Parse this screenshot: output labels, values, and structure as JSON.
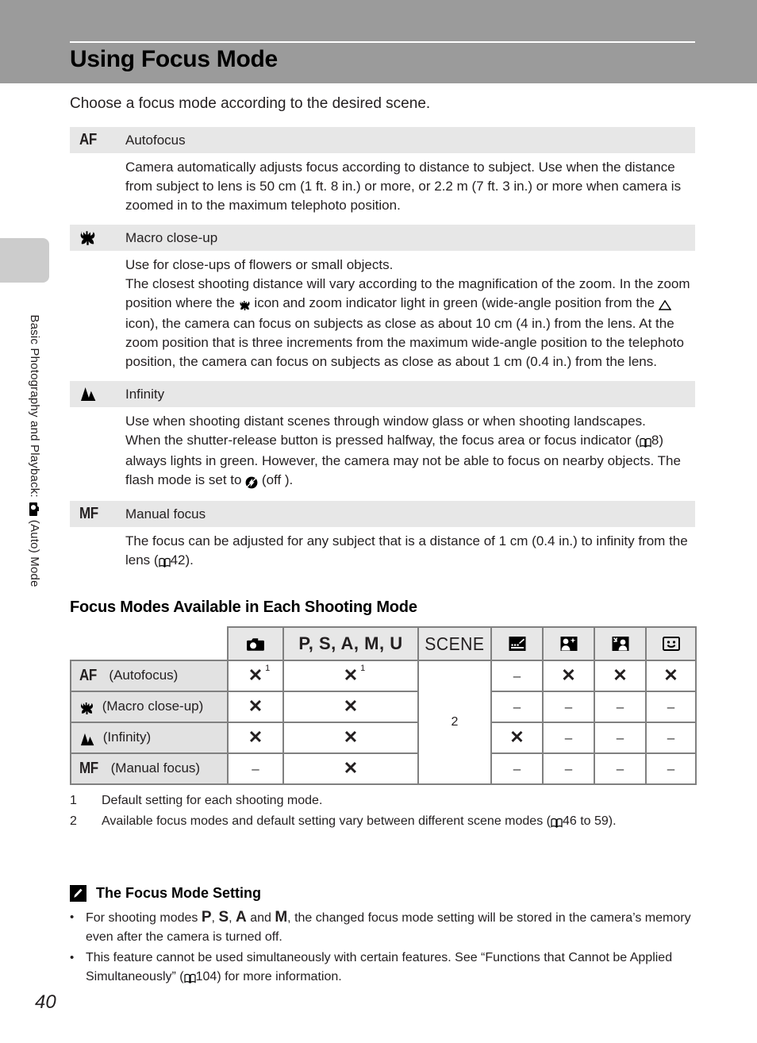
{
  "header": {
    "title": "Using Focus Mode"
  },
  "sidebar": {
    "chapter_label_part1": "Basic Photography and Playback:",
    "chapter_label_part2": "(Auto) Mode",
    "camera_icon": "camera-icon"
  },
  "intro": "Choose a focus mode according to the desired scene.",
  "modes": [
    {
      "icon": "af-icon",
      "icon_text": "AF",
      "name": "Autofocus",
      "body": "Camera automatically adjusts focus according to distance to subject. Use when the distance from subject to lens is 50 cm (1 ft. 8 in.) or more, or 2.2 m (7 ft. 3 in.) or more when camera is zoomed in to the maximum telephoto position."
    },
    {
      "icon": "macro-tulip-icon",
      "icon_text": "",
      "name": "Macro close-up",
      "body_part1": "Use for close-ups of flowers or small objects.",
      "body_part2": "The closest shooting distance will vary according to the magnification of the zoom. In the zoom position where the ",
      "body_part3": " icon and zoom indicator light in green (wide-angle position from the ",
      "body_part4": " icon), the camera can focus on subjects as close as about 10 cm (4 in.) from the lens. At the zoom position that is three increments from the maximum wide-angle position to the telephoto position, the camera can focus on subjects as close as about 1 cm (0.4 in.) from the lens."
    },
    {
      "icon": "infinity-mountain-icon",
      "icon_text": "",
      "name": "Infinity",
      "body_part1": "Use when shooting distant scenes through window glass or when shooting landscapes.",
      "body_part2": "When the shutter-release button is pressed halfway, the focus area or focus indicator (",
      "body_ref_page": "8",
      "body_part3": ") always lights in green. However, the camera may not be able to focus on nearby objects. The flash mode is set to ",
      "body_part4": " (off )."
    },
    {
      "icon": "mf-icon",
      "icon_text": "MF",
      "name": "Manual focus",
      "body_part1": "The focus can be adjusted for any subject that is a distance of 1 cm (0.4 in.) to infinity from the lens (",
      "body_ref_page": "42",
      "body_part2": ")."
    }
  ],
  "table_section": {
    "heading": "Focus Modes Available in Each Shooting Mode",
    "columns": [
      {
        "id": "mode-col",
        "label": ""
      },
      {
        "id": "auto-mode",
        "label": "",
        "icon": "camera-icon"
      },
      {
        "id": "psamu-modes",
        "label": "P, S, A, M, U"
      },
      {
        "id": "scene-mode",
        "label": "SCENE"
      },
      {
        "id": "night-landscape-mode",
        "label": "",
        "icon": "night-landscape-icon"
      },
      {
        "id": "night-portrait-mode",
        "label": "",
        "icon": "night-portrait-icon"
      },
      {
        "id": "backlight-mode",
        "label": "",
        "icon": "backlight-icon"
      },
      {
        "id": "smart-portrait-mode",
        "label": "",
        "icon": "smile-icon"
      }
    ],
    "rows": [
      {
        "icon": "af-icon",
        "icon_text": "AF",
        "label": "(Autofocus)",
        "cells": [
          "check1",
          "check1",
          "scene",
          "dash",
          "check",
          "check",
          "check"
        ]
      },
      {
        "icon": "macro-tulip-icon",
        "icon_text": "",
        "label": "(Macro close-up)",
        "cells": [
          "check",
          "check",
          "scene",
          "dash",
          "dash",
          "dash",
          "dash"
        ]
      },
      {
        "icon": "infinity-mountain-icon",
        "icon_text": "",
        "label": "(Infinity)",
        "cells": [
          "check",
          "check",
          "scene",
          "check",
          "dash",
          "dash",
          "dash"
        ]
      },
      {
        "icon": "mf-icon",
        "icon_text": "MF",
        "label": "(Manual focus)",
        "cells": [
          "dash",
          "check",
          "scene",
          "dash",
          "dash",
          "dash",
          "dash"
        ]
      }
    ],
    "scene_cell_value": "2",
    "check_superscript": "1"
  },
  "footnotes": [
    {
      "num": "1",
      "text": "Default setting for each shooting mode."
    },
    {
      "num": "2",
      "text_part1": "Available focus modes and default setting vary between different scene modes (",
      "ref_page": "46 to 59",
      "text_part2": ")."
    }
  ],
  "note": {
    "icon": "pencil-note-icon",
    "title": "The Focus Mode Setting",
    "bullet_char": "•",
    "items": [
      {
        "part1": "For shooting modes ",
        "mode1": "P",
        "sep1": ", ",
        "mode2": "S",
        "sep2": ", ",
        "mode3": "A",
        "sep3": " and ",
        "mode4": "M",
        "part2": ", the changed focus mode setting will be stored in the camera’s memory even after the camera is turned off."
      },
      {
        "part1": "This feature cannot be used simultaneously with certain features. See “Functions that Cannot be Applied Simultaneously” (",
        "ref_page": "104",
        "part2": ") for more information."
      }
    ]
  },
  "page_number": "40",
  "colors": {
    "header_band": "#9b9b9b",
    "row_header_gray": "#e2e2e2",
    "mode_head_gray": "#e7e7e7",
    "table_border": "#808080",
    "side_tab": "#cccccc",
    "text": "#231f20"
  }
}
